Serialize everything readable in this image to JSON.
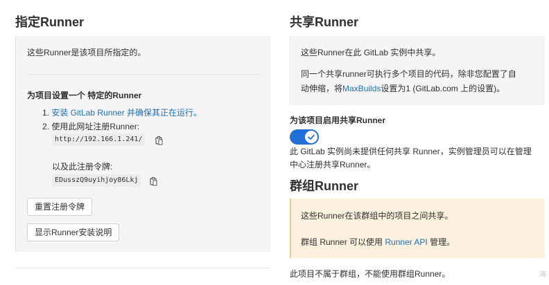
{
  "left": {
    "title": "指定Runner",
    "intro": "这些Runner是该项目所指定的。",
    "setup_heading": "为项目设置一个 特定的Runner",
    "step1_prefix": "1. ",
    "step1_link": "安装 GitLab Runner 并确保其正在运行。",
    "step2": "2. 使用此网址注册Runner:",
    "register_url": "http://192.166.1.241/",
    "token_label": "以及此注册令牌:",
    "token_value": "EDusszQ9uyihjoy86Lkj",
    "reset_button": "重置注册令牌",
    "show_install_button": "显示Runner安装说明"
  },
  "right": {
    "title": "共享Runner",
    "shared_intro": "这些Runner在此 GitLab 实例中共享。",
    "shared_desc_line1": "同一个共享runner可执行多个项目的代码，除非您配置了自",
    "shared_desc_line2_prefix": "动伸缩，将",
    "shared_desc_link": "MaxBuilds",
    "shared_desc_line2_suffix": "设置为1 (GitLab.com 上的设置)。",
    "enable_label": "为该项目启用共享Runner",
    "enable_toggle_on": true,
    "no_shared_line1": "此 GitLab 实例尚未提供任何共享 Runner，实例管理员可以在管理",
    "no_shared_line2": "中心注册共享Runner。",
    "group_title": "群组Runner",
    "group_intro": "这些Runner在该群组中的项目之间共享。",
    "group_desc_prefix": "群组 Runner 可以使用 ",
    "group_desc_link": "Runner API",
    "group_desc_suffix": " 管理。",
    "no_group": "此项目不属于群组，不能使用群组Runner。"
  },
  "scroll_glyph": "海",
  "colors": {
    "link": "#1f6fb6",
    "toggle": "#1f6fd6",
    "warning_bg": "#fcf0de"
  },
  "icons": [
    "copy-icon",
    "check-icon"
  ]
}
